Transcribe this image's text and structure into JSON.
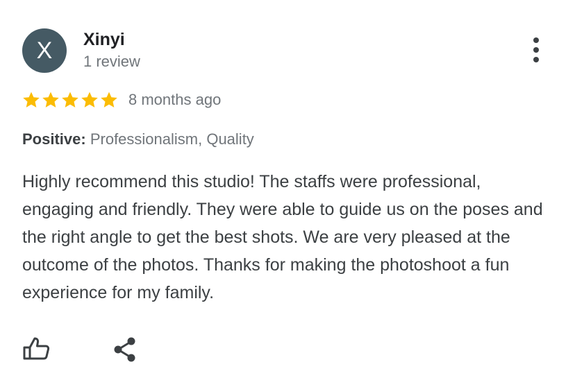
{
  "review": {
    "author": {
      "initial": "X",
      "name": "Xinyi",
      "review_count": "1 review",
      "avatar_color": "#455a64"
    },
    "rating": {
      "stars": 5,
      "max_stars": 5,
      "star_color": "#fbbc04"
    },
    "time_ago": "8 months ago",
    "attributes": {
      "label": "Positive:",
      "values": "Professionalism, Quality"
    },
    "text": "Highly recommend this studio! The staffs were professional, engaging and friendly. They were able to guide us on the poses and the right angle to get the best shots. We are very pleased at the outcome of the photos. Thanks for making the photoshoot a fun experience for my family."
  },
  "icons": {
    "more": "more-vert-icon",
    "like": "thumbs-up-icon",
    "share": "share-icon",
    "star": "star-icon"
  }
}
